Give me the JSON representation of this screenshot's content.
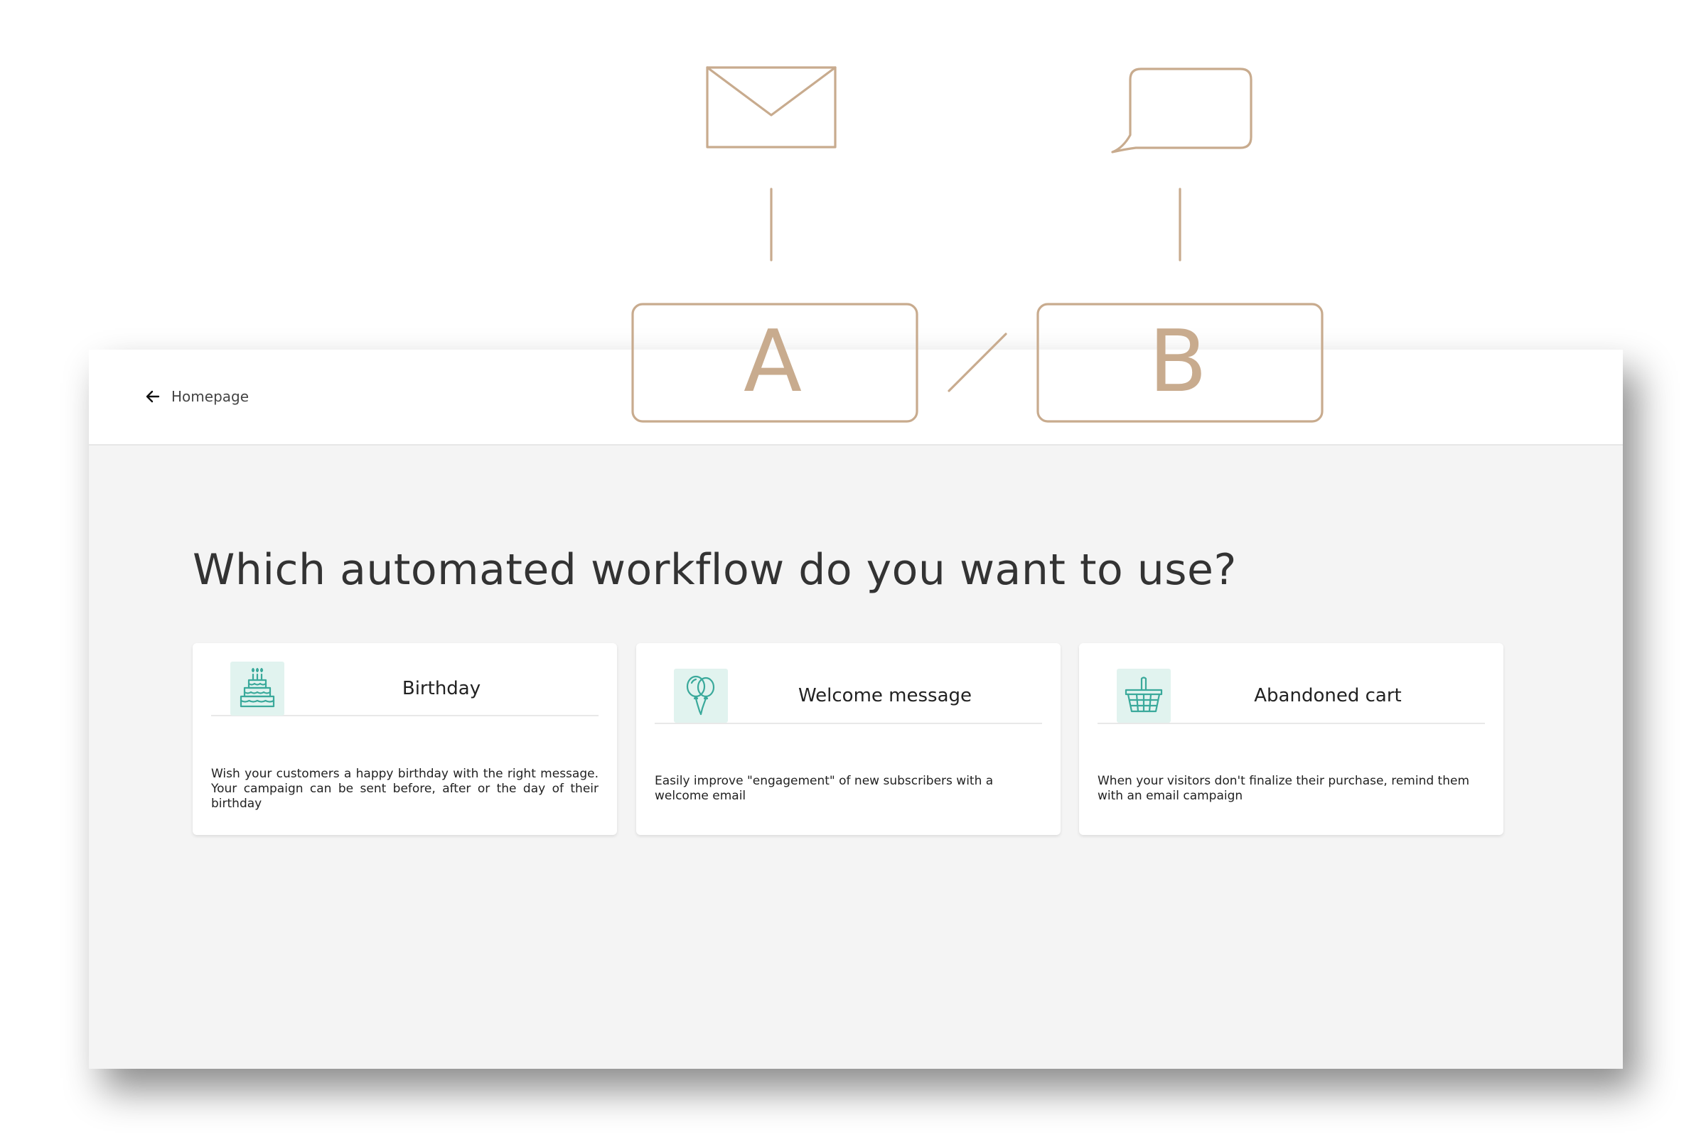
{
  "header": {
    "back_label": "Homepage",
    "back_icon": "arrow-left-icon"
  },
  "main": {
    "title": "Which automated workflow do you want to use?",
    "cards": [
      {
        "title": "Birthday",
        "icon": "birthday-cake-icon",
        "description": "Wish your customers a happy birthday with the right message. Your campaign can be sent before, after or the day of their birthday"
      },
      {
        "title": "Welcome message",
        "icon": "balloons-icon",
        "description": "Easily improve \"engagement\" of new subscribers with a welcome email"
      },
      {
        "title": "Abandoned cart",
        "icon": "shopping-basket-icon",
        "description": "When your visitors don't finalize their purchase, remind them with an email campaign"
      }
    ]
  },
  "illustration": {
    "variant_a": "A",
    "variant_b": "B",
    "icons": [
      "envelope-icon",
      "chat-bubble-icon"
    ]
  },
  "colors": {
    "illustration_stroke": "#c8ab8e",
    "icon_accent": "#3aa99b",
    "icon_background": "#e1f3ef",
    "page_background": "#f4f4f4"
  }
}
